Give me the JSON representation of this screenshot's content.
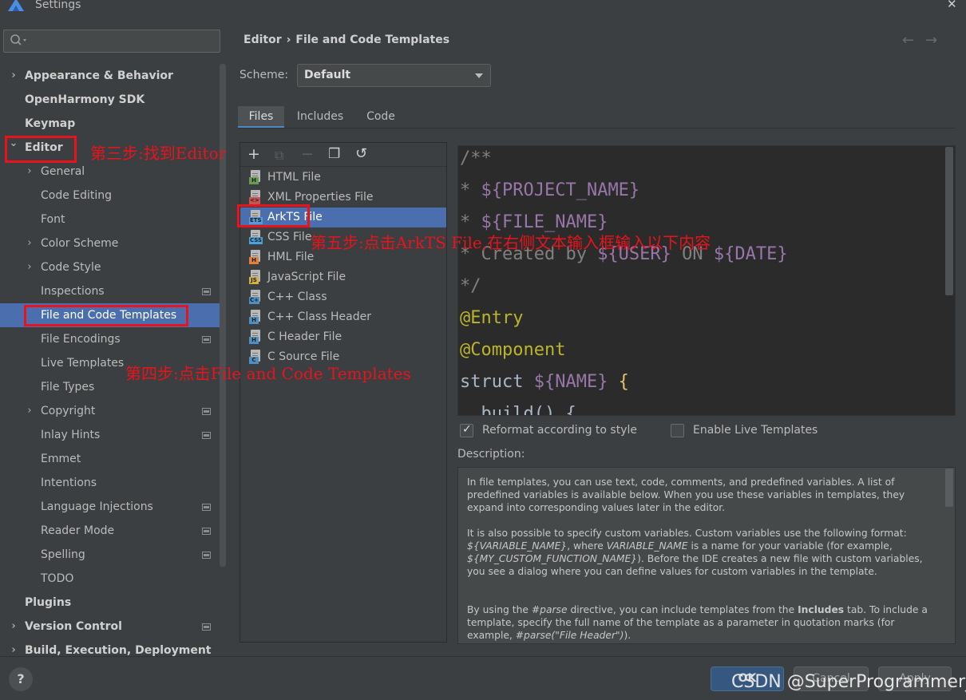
{
  "window": {
    "title": "Settings",
    "close_icon": "close-icon"
  },
  "search": {
    "value": "",
    "placeholder": ""
  },
  "tree": [
    {
      "label": "Appearance & Behavior",
      "bold": true,
      "arrow": "›",
      "indent": 0
    },
    {
      "label": "OpenHarmony SDK",
      "bold": true,
      "arrow": "",
      "indent": 0
    },
    {
      "label": "Keymap",
      "bold": true,
      "arrow": "",
      "indent": 0
    },
    {
      "label": "Editor",
      "bold": true,
      "arrow": "⌄",
      "indent": 0
    },
    {
      "label": "General",
      "bold": false,
      "arrow": "›",
      "indent": 1
    },
    {
      "label": "Code Editing",
      "bold": false,
      "arrow": "",
      "indent": 1
    },
    {
      "label": "Font",
      "bold": false,
      "arrow": "",
      "indent": 1
    },
    {
      "label": "Color Scheme",
      "bold": false,
      "arrow": "›",
      "indent": 1
    },
    {
      "label": "Code Style",
      "bold": false,
      "arrow": "›",
      "indent": 1
    },
    {
      "label": "Inspections",
      "bold": false,
      "arrow": "",
      "indent": 1,
      "project": true
    },
    {
      "label": "File and Code Templates",
      "bold": false,
      "arrow": "",
      "indent": 1,
      "selected": true
    },
    {
      "label": "File Encodings",
      "bold": false,
      "arrow": "",
      "indent": 1,
      "project": true
    },
    {
      "label": "Live Templates",
      "bold": false,
      "arrow": "",
      "indent": 1
    },
    {
      "label": "File Types",
      "bold": false,
      "arrow": "",
      "indent": 1
    },
    {
      "label": "Copyright",
      "bold": false,
      "arrow": "›",
      "indent": 1,
      "project": true
    },
    {
      "label": "Inlay Hints",
      "bold": false,
      "arrow": "",
      "indent": 1,
      "project": true
    },
    {
      "label": "Emmet",
      "bold": false,
      "arrow": "",
      "indent": 1
    },
    {
      "label": "Intentions",
      "bold": false,
      "arrow": "",
      "indent": 1
    },
    {
      "label": "Language Injections",
      "bold": false,
      "arrow": "",
      "indent": 1,
      "project": true
    },
    {
      "label": "Reader Mode",
      "bold": false,
      "arrow": "",
      "indent": 1,
      "project": true
    },
    {
      "label": "Spelling",
      "bold": false,
      "arrow": "",
      "indent": 1,
      "project": true
    },
    {
      "label": "TODO",
      "bold": false,
      "arrow": "",
      "indent": 1
    },
    {
      "label": "Plugins",
      "bold": true,
      "arrow": "",
      "indent": 0
    },
    {
      "label": "Version Control",
      "bold": true,
      "arrow": "›",
      "indent": 0,
      "project": true
    },
    {
      "label": "Build, Execution, Deployment",
      "bold": true,
      "arrow": "›",
      "indent": 0
    }
  ],
  "breadcrumb": {
    "part1": "Editor",
    "separator": "›",
    "part2": "File and Code Templates"
  },
  "nav": {
    "back": "←",
    "forward": "→"
  },
  "scheme": {
    "label": "Scheme:",
    "value": "Default"
  },
  "tabs": [
    "Files",
    "Includes",
    "Code"
  ],
  "active_tab": "Files",
  "toolbar": {
    "add": "+",
    "add_child": "⧉",
    "remove": "−",
    "copy": "❐",
    "reset": "↺"
  },
  "files": [
    {
      "name": "HTML File",
      "badge": "H",
      "color": "#6a9955"
    },
    {
      "name": "XML Properties File",
      "badge": "<>",
      "color": "#c75450"
    },
    {
      "name": "ArkTS File",
      "badge": "ETS",
      "color": "#5a9bd5",
      "selected": true
    },
    {
      "name": "CSS File",
      "badge": "CSS",
      "color": "#4aa3d9"
    },
    {
      "name": "HML File",
      "badge": "H",
      "color": "#e0803a"
    },
    {
      "name": "JavaScript File",
      "badge": "JS",
      "color": "#d4b13a"
    },
    {
      "name": "C++ Class",
      "badge": "C+",
      "color": "#4f8fc0"
    },
    {
      "name": "C++ Class Header",
      "badge": "H",
      "color": "#4f8fc0"
    },
    {
      "name": "C Header File",
      "badge": "H",
      "color": "#4f8fc0"
    },
    {
      "name": "C Source File",
      "badge": "C",
      "color": "#4f8fc0"
    }
  ],
  "code": {
    "l1": "/**",
    "l2_star": "* ",
    "l2_var": "${PROJECT_NAME}",
    "l3_star": "* ",
    "l3_var": "${FILE_NAME}",
    "l4_pre": "* Created by ",
    "l4_var1": "${USER}",
    "l4_mid": " ON ",
    "l4_var2": "${DATE}",
    "l5": "*/",
    "l6_at": "@",
    "l6_name": "Entry",
    "l7_at": "@",
    "l7_name": "Component",
    "l8_kw": "struct ",
    "l8_var": "${NAME}",
    "l8_brace": " {",
    "l9": "  build() {"
  },
  "options": {
    "reformat": {
      "label": "Reformat according to style",
      "checked": true
    },
    "live_templates": {
      "label": "Enable Live Templates",
      "checked": false
    }
  },
  "description": {
    "label": "Description:",
    "p1": "In file templates, you can use text, code, comments, and predefined variables. A list of predefined variables is available below. When you use these variables in templates, they expand into corresponding values later in the editor.",
    "p2_a": "It is also possible to specify custom variables. Custom variables use the following format: ",
    "p2_b": "${VARIABLE_NAME}",
    "p2_c": ", where ",
    "p2_d": "VARIABLE_NAME",
    "p2_e": " is a name for your variable (for example, ",
    "p2_f": "${MY_CUSTOM_FUNCTION_NAME}",
    "p2_g": "). Before the IDE creates a new file with custom variables, you see a dialog where you can define values for custom variables in the template.",
    "p3_a": "By using the ",
    "p3_b": "#parse",
    "p3_c": " directive, you can include templates from the ",
    "p3_d": "Includes",
    "p3_e": " tab. To include a template, specify the full name of the template as a parameter in quotation marks (for example, ",
    "p3_f": "#parse(\"File Header\")",
    "p3_g": ")."
  },
  "footer": {
    "help": "?",
    "ok": "OK",
    "cancel": "Cancel",
    "apply": "Apply"
  },
  "watermark": "CSDN @SuperProgrammer_",
  "annotations": {
    "step3": "第三步:找到Editor",
    "step4": "第四步:点击File and Code Templates",
    "step5": "第五步:点击ArkTS File,在右侧文本输入框输入以下内容"
  },
  "colors": {
    "accent": "#4b6eaf",
    "annotation": "#e8131b",
    "background": "#3c3f41",
    "editor": "#2b2b2b"
  }
}
